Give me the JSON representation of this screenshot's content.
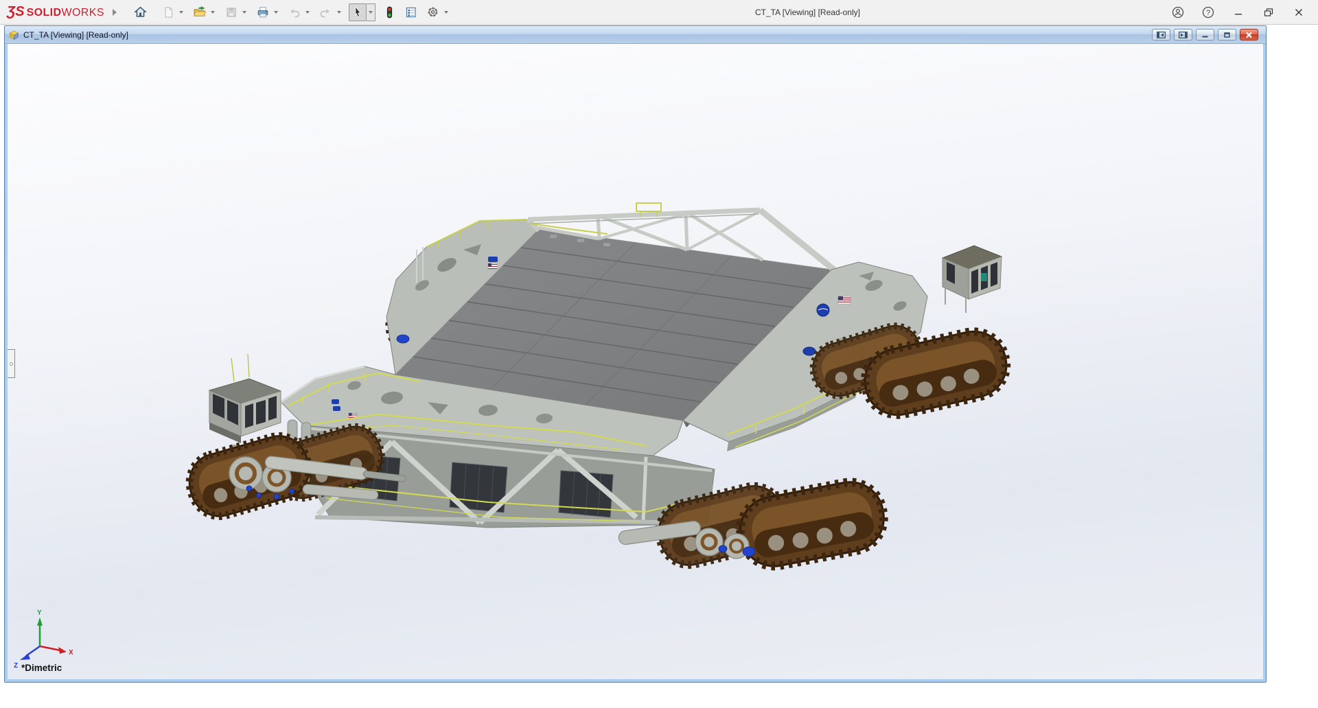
{
  "window": {
    "brand": {
      "glyph": "ƷS",
      "solid": "SOLID",
      "works": "WORKS",
      "color": "#cf1f2e"
    },
    "title": "CT_TA [Viewing] [Read-only]",
    "controls": [
      "user-account",
      "help",
      "minimize",
      "restore-down",
      "close"
    ]
  },
  "glyphs": {
    "help": "?"
  },
  "toolbar": {
    "buttons": [
      {
        "name": "home",
        "enabled": true,
        "dropdown": false
      },
      {
        "name": "new-document",
        "enabled": false,
        "dropdown": true
      },
      {
        "name": "open",
        "enabled": true,
        "dropdown": true
      },
      {
        "name": "save",
        "enabled": false,
        "dropdown": true
      },
      {
        "name": "print",
        "enabled": true,
        "dropdown": true
      },
      {
        "name": "undo",
        "enabled": false,
        "dropdown": true
      },
      {
        "name": "redo",
        "enabled": false,
        "dropdown": true
      },
      {
        "name": "select",
        "enabled": true,
        "active": true,
        "dropdown": true
      },
      {
        "name": "rebuild-traffic-light",
        "enabled": true,
        "dropdown": false
      },
      {
        "name": "file-properties",
        "enabled": true,
        "dropdown": false
      },
      {
        "name": "options",
        "enabled": true,
        "dropdown": true
      }
    ]
  },
  "document": {
    "title": "CT_TA [Viewing] [Read-only]",
    "caption_buttons": [
      "dock-pane-left",
      "dock-pane-right",
      "minimize",
      "restore",
      "close"
    ],
    "view_orientation": "*Dimetric",
    "triad": {
      "x_label": "X",
      "y_label": "Y",
      "z_label": "Z",
      "x_color": "#cc2127",
      "y_color": "#1e9e33",
      "z_color": "#2b3fd6"
    },
    "model": {
      "name": "crawler-transporter-assembly",
      "parts": [
        "flat-top-deck",
        "truss-frame",
        "eight-crawler-tracks",
        "operator-cabs",
        "nasa-meatball-decals",
        "us-flag-decals",
        "yellow-handrails"
      ]
    }
  },
  "colors": {
    "doc_titlebar_gradient_top": "#dceafa",
    "doc_titlebar_gradient_bottom": "#a8c3e2",
    "viewport_border": "#aacdf0",
    "deck_gray": "#7e8082",
    "body_gray": "#bfc4be",
    "track_brown": "#5f3e1d",
    "handrail_yellow": "#d4da50",
    "nasa_blue": "#1d3eae",
    "close_button_red": "#c23a2b"
  }
}
